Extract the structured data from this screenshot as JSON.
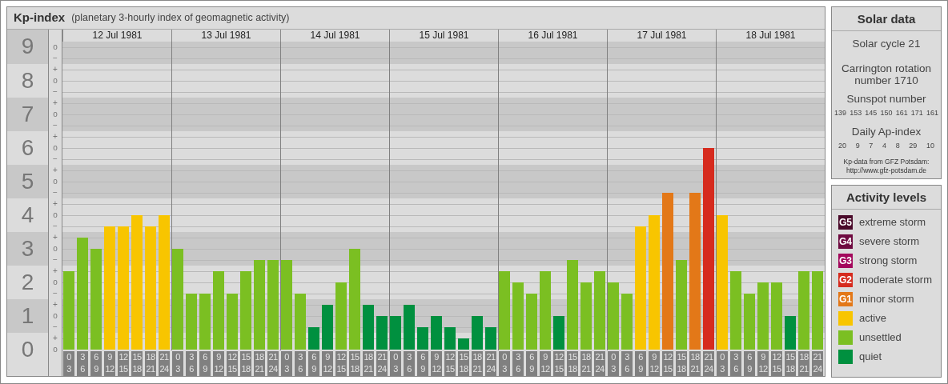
{
  "kp_panel": {
    "title": "Kp-index",
    "subtitle": "(planetary 3-hourly index of geomagnetic activity)",
    "days": [
      "12 Jul 1981",
      "13 Jul 1981",
      "14 Jul 1981",
      "15 Jul 1981",
      "16 Jul 1981",
      "17 Jul 1981",
      "18 Jul 1981"
    ],
    "scale_marks": [
      "o",
      "−",
      "+",
      "o",
      "−",
      "+",
      "o",
      "−",
      "+",
      "o",
      "−",
      "+",
      "o",
      "−",
      "+",
      "o",
      "−",
      "+",
      "o",
      "−",
      "+",
      "o",
      "−",
      "+",
      "o",
      "−",
      "+",
      "o"
    ],
    "chart_data": {
      "type": "bar",
      "grid": true,
      "ylim": [
        0,
        9
      ],
      "yticks": [
        0,
        1,
        2,
        3,
        4,
        5,
        6,
        7,
        8,
        9
      ],
      "categories": [
        "0\n3",
        "3\n6",
        "6\n9",
        "9\n12",
        "12\n15",
        "15\n18",
        "18\n21",
        "21\n24",
        "0\n3",
        "3\n6",
        "6\n9",
        "9\n12",
        "12\n15",
        "15\n18",
        "18\n21",
        "21\n24",
        "0\n3",
        "3\n6",
        "6\n9",
        "9\n12",
        "12\n15",
        "15\n18",
        "18\n21",
        "21\n24",
        "0\n3",
        "3\n6",
        "6\n9",
        "9\n12",
        "12\n15",
        "15\n18",
        "18\n21",
        "21\n24",
        "0\n3",
        "3\n6",
        "6\n9",
        "9\n12",
        "12\n15",
        "15\n18",
        "18\n21",
        "21\n24",
        "0\n3",
        "3\n6",
        "6\n9",
        "9\n12",
        "12\n15",
        "15\n18",
        "18\n21",
        "21\n24",
        "0\n3",
        "3\n6",
        "6\n9",
        "9\n12",
        "12\n15",
        "15\n18",
        "18\n21",
        "21\n24"
      ],
      "series": [
        {
          "color": "#00903f",
          "values": [
            null,
            null,
            null,
            null,
            null,
            null,
            null,
            null,
            null,
            null,
            null,
            null,
            null,
            null,
            null,
            null,
            null,
            null,
            0.67,
            1.33,
            null,
            null,
            1.33,
            1,
            1,
            1.33,
            0.67,
            1,
            0.67,
            0.33,
            1,
            0.67,
            null,
            null,
            null,
            null,
            1,
            null,
            null,
            null,
            null,
            null,
            null,
            null,
            null,
            null,
            null,
            null,
            null,
            null,
            null,
            null,
            null,
            1,
            null,
            null
          ]
        },
        {
          "color": "#7bbf22",
          "values": [
            2.33,
            3.33,
            3,
            null,
            null,
            null,
            null,
            null,
            3,
            1.67,
            1.67,
            2.33,
            1.67,
            2.33,
            2.67,
            2.67,
            2.67,
            1.67,
            null,
            null,
            2,
            3,
            null,
            null,
            null,
            null,
            null,
            null,
            null,
            null,
            null,
            null,
            2.33,
            2,
            1.67,
            2.33,
            null,
            2.67,
            2,
            2.33,
            2,
            1.67,
            null,
            null,
            null,
            2.67,
            null,
            null,
            null,
            2.33,
            1.67,
            2,
            2,
            null,
            2.33,
            2.33
          ]
        },
        {
          "color": "#f8c500",
          "values": [
            null,
            null,
            null,
            3.67,
            3.67,
            4,
            3.67,
            4,
            null,
            null,
            null,
            null,
            null,
            null,
            null,
            null,
            null,
            null,
            null,
            null,
            null,
            null,
            null,
            null,
            null,
            null,
            null,
            null,
            null,
            null,
            null,
            null,
            null,
            null,
            null,
            null,
            null,
            null,
            null,
            null,
            null,
            null,
            3.67,
            4,
            null,
            null,
            null,
            null,
            4,
            null,
            null,
            null,
            null,
            null,
            null,
            null
          ]
        },
        {
          "color": "#e37818",
          "values": [
            null,
            null,
            null,
            null,
            null,
            null,
            null,
            null,
            null,
            null,
            null,
            null,
            null,
            null,
            null,
            null,
            null,
            null,
            null,
            null,
            null,
            null,
            null,
            null,
            null,
            null,
            null,
            null,
            null,
            null,
            null,
            null,
            null,
            null,
            null,
            null,
            null,
            null,
            null,
            null,
            null,
            null,
            null,
            null,
            4.67,
            null,
            4.67,
            null,
            null,
            null,
            null,
            null,
            null,
            null,
            null,
            null
          ]
        },
        {
          "color": "#d62b1e",
          "values": [
            null,
            null,
            null,
            null,
            null,
            null,
            null,
            null,
            null,
            null,
            null,
            null,
            null,
            null,
            null,
            null,
            null,
            null,
            null,
            null,
            null,
            null,
            null,
            null,
            null,
            null,
            null,
            null,
            null,
            null,
            null,
            null,
            null,
            null,
            null,
            null,
            null,
            null,
            null,
            null,
            null,
            null,
            null,
            null,
            null,
            null,
            null,
            6,
            null,
            null,
            null,
            null,
            null,
            null,
            null,
            null
          ]
        }
      ]
    }
  },
  "solar_data": {
    "title": "Solar data",
    "solar_cycle": "Solar cycle 21",
    "carrington": "Carrington rotation number 1710",
    "sunspot_title": "Sunspot number",
    "sunspot_numbers": [
      "139",
      "153",
      "145",
      "150",
      "161",
      "171",
      "161"
    ],
    "ap_title": "Daily Ap-index",
    "ap_values": [
      "20",
      "9",
      "7",
      "4",
      "8",
      "29",
      "10"
    ],
    "source": "Kp-data from GFZ Potsdam:",
    "source_url": "http://www.gfz-potsdam.de"
  },
  "activity_levels": {
    "title": "Activity levels",
    "items": [
      {
        "badge": "G5",
        "label": "extreme storm",
        "color": "#4a0a2a"
      },
      {
        "badge": "G4",
        "label": "severe storm",
        "color": "#6e0a40"
      },
      {
        "badge": "G3",
        "label": "strong storm",
        "color": "#a3085c"
      },
      {
        "badge": "G2",
        "label": "moderate storm",
        "color": "#d62b1e"
      },
      {
        "badge": "G1",
        "label": "minor storm",
        "color": "#e37818"
      },
      {
        "label": "active",
        "color": "#f8c500"
      },
      {
        "label": "unsettled",
        "color": "#7bbf22"
      },
      {
        "label": "quiet",
        "color": "#00903f"
      }
    ]
  }
}
